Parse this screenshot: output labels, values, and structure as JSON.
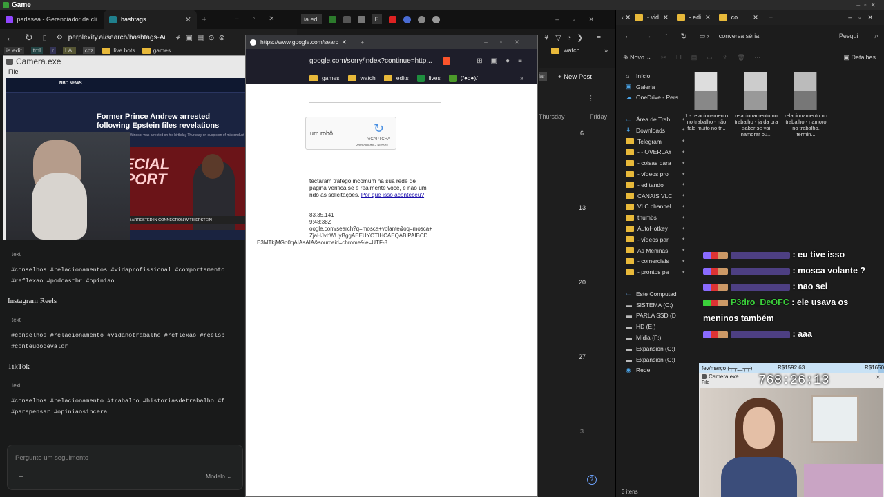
{
  "app": {
    "title": "Game"
  },
  "browser1": {
    "tabs": [
      "parlasea - Gerenciador de clip",
      "hashtags"
    ],
    "url": "perplexity.ai/search/hashtags-Am",
    "bookmarks": [
      "ia edit",
      "tml",
      "r",
      "I.A.",
      "ccz",
      "live bots",
      "games"
    ],
    "chip": "text",
    "lines": [
      "#conselhos #relacionamentos #vidaprofissional #comportamento",
      "#reflexao #podcastbr #opiniao"
    ],
    "sections": [
      {
        "title": "Instagram Reels",
        "lines": [
          "#conselhos #relacionamento #vidanotrabalho #reflexao #reelsb",
          "#conteudodevalor"
        ]
      },
      {
        "title": "TikTok",
        "lines": [
          "#conselhos #relacionamento #trabalho #historiasdetrabalho #f",
          "#parapensar #opiniaosincera"
        ]
      }
    ],
    "followup_placeholder": "Pergunte um seguimento",
    "model_label": "Modelo",
    "add": "+"
  },
  "camera1": {
    "title": "Camera.exe",
    "menu": "File",
    "news_logo": "NBC NEWS",
    "headline": "Former Prince Andrew arrested following Epstein files revelations",
    "subhead": "Andrew Mountbatten-Windsor was arrested on his birthday Thursday on suspicion of misconduct in public office.",
    "special1": "SPECIAL",
    "special2": "REPORT",
    "lower_third": "PRINCE ANDREW ARRESTED IN CONNECTION WITH EPSTEIN"
  },
  "browser2": {
    "tabs": [
      "ia edi",
      "E"
    ],
    "popup_url": "https://www.google.com/search",
    "url": "google.com/sorry/index?continue=http...",
    "bookmarks": [
      "games",
      "watch",
      "edits",
      "lives",
      "(/●ɔ●)/"
    ],
    "bookmark_watch": "watch",
    "captcha_text": "um robô",
    "recaptcha": "reCAPTCHA",
    "recaptcha_links": "Privacidade - Termos",
    "sorry_lines": [
      "tectaram tráfego incomum na sua rede de",
      "página verifica se é realmente você, e não um",
      "ndo as solicitações."
    ],
    "sorry_link": "Por que isso aconteceu?",
    "ip_lines": [
      "83.35.141",
      "9:48:38Z",
      "oogle.com/search?q=mosca+volante&oq=mosca+",
      "ZjaHJvbWUyBggAEEUYOTIHCAEQABiPAIBCD",
      "E3MTkjMGo0qAIAsAIA&sourceid=chrome&ie=UTF-8"
    ]
  },
  "calendar": {
    "new_post": "+ New Post",
    "bar_label": "lar",
    "days": [
      "Thursday",
      "Friday"
    ],
    "dates": [
      "6",
      "13",
      "20",
      "27",
      "3"
    ]
  },
  "explorer": {
    "tabs": [
      "- vid",
      "- edi",
      "co"
    ],
    "address": "conversa séria",
    "search": "Pesqui",
    "new_label": "Novo",
    "details_label": "Detalhes",
    "tree": [
      {
        "label": "Início",
        "kind": "home"
      },
      {
        "label": "Galeria",
        "kind": "gallery"
      },
      {
        "label": "OneDrive - Pers",
        "kind": "cloud"
      },
      {
        "label": "",
        "kind": "gap"
      },
      {
        "label": "Área de Trab",
        "kind": "desk"
      },
      {
        "label": "Downloads",
        "kind": "down"
      },
      {
        "label": "Telegram",
        "kind": "folder"
      },
      {
        "label": "- - OVERLAY",
        "kind": "folder"
      },
      {
        "label": "- coisas para",
        "kind": "folder"
      },
      {
        "label": "- vídeos pro",
        "kind": "folder"
      },
      {
        "label": "- editando",
        "kind": "folder"
      },
      {
        "label": "CANAIS VLC",
        "kind": "folder"
      },
      {
        "label": "VLC channel",
        "kind": "folder"
      },
      {
        "label": "thumbs",
        "kind": "folder"
      },
      {
        "label": "AutoHotkey",
        "kind": "folder"
      },
      {
        "label": "- vídeos par",
        "kind": "folder"
      },
      {
        "label": "As Meninas",
        "kind": "folder"
      },
      {
        "label": "- comerciais",
        "kind": "folder"
      },
      {
        "label": "- prontos pa",
        "kind": "folder"
      },
      {
        "label": "",
        "kind": "gap"
      },
      {
        "label": "Este Computad",
        "kind": "pc"
      },
      {
        "label": "SISTEMA (C:)",
        "kind": "drive"
      },
      {
        "label": "PARLA SSD (D",
        "kind": "drive"
      },
      {
        "label": "HD (E:)",
        "kind": "drive"
      },
      {
        "label": "Mídia (F:)",
        "kind": "drive"
      },
      {
        "label": "Expansion (G:)",
        "kind": "drive"
      },
      {
        "label": "Expansion (G:)",
        "kind": "drive"
      },
      {
        "label": "Rede",
        "kind": "net"
      }
    ],
    "files": [
      "1 - relacionamento no trabalho - não fale muito no tr...",
      "relacionamento no trabalho - ja da pra saber se vai namorar ou...",
      "relacionamento no trabalho - namoro no trabalho, termin..."
    ],
    "status": "3 itens"
  },
  "chat": {
    "messages": [
      {
        "user": "",
        "text": "eu tive isso",
        "color": "#8a6bff"
      },
      {
        "user": "",
        "text": "mosca volante ?",
        "color": "#8a6bff"
      },
      {
        "user": "",
        "text": "nao sei",
        "color": "#8a6bff"
      },
      {
        "user": "P3dro_DeOFC",
        "text": "ele usava os meninos também",
        "color": "#3bd13b"
      },
      {
        "user": "",
        "text": "aaa",
        "color": "#8a6bff"
      }
    ]
  },
  "goal": {
    "label": "fev/março (┬┬﹏┬┬)",
    "amount1": "R$1592.63",
    "amount2": "R$1650",
    "progress": 0.965
  },
  "camera2": {
    "title": "Camera.exe",
    "menu": "File",
    "timer": "768:26:13"
  }
}
